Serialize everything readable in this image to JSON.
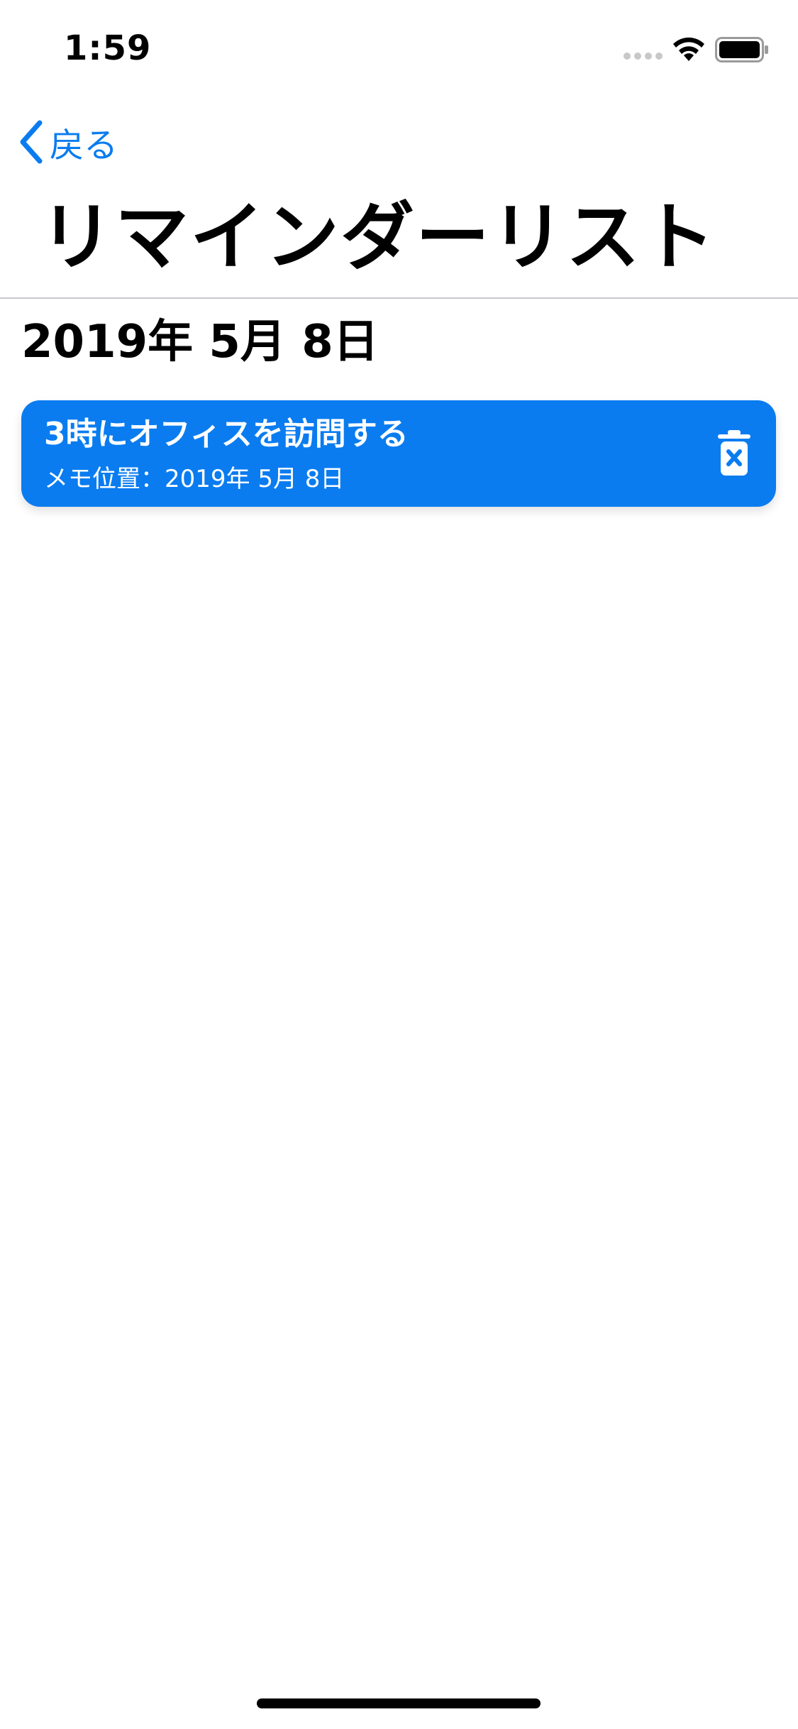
{
  "status_bar": {
    "time": "1:59",
    "icons": [
      "cellular-signal-icon",
      "wifi-icon",
      "battery-icon"
    ]
  },
  "nav": {
    "back_label": "戻る",
    "back_icon": "chevron-left-icon"
  },
  "page": {
    "title": "リマインダーリスト",
    "section_date": "2019年 5月 8日"
  },
  "reminders": [
    {
      "title": "3時にオフィスを訪問する",
      "subtitle": "メモ位置：2019年 5月 8日",
      "delete_icon": "trash-icon"
    }
  ],
  "colors": {
    "accent": "#0a7cf0",
    "background": "#ffffff",
    "divider": "#c8c7cc",
    "text": "#000000"
  }
}
